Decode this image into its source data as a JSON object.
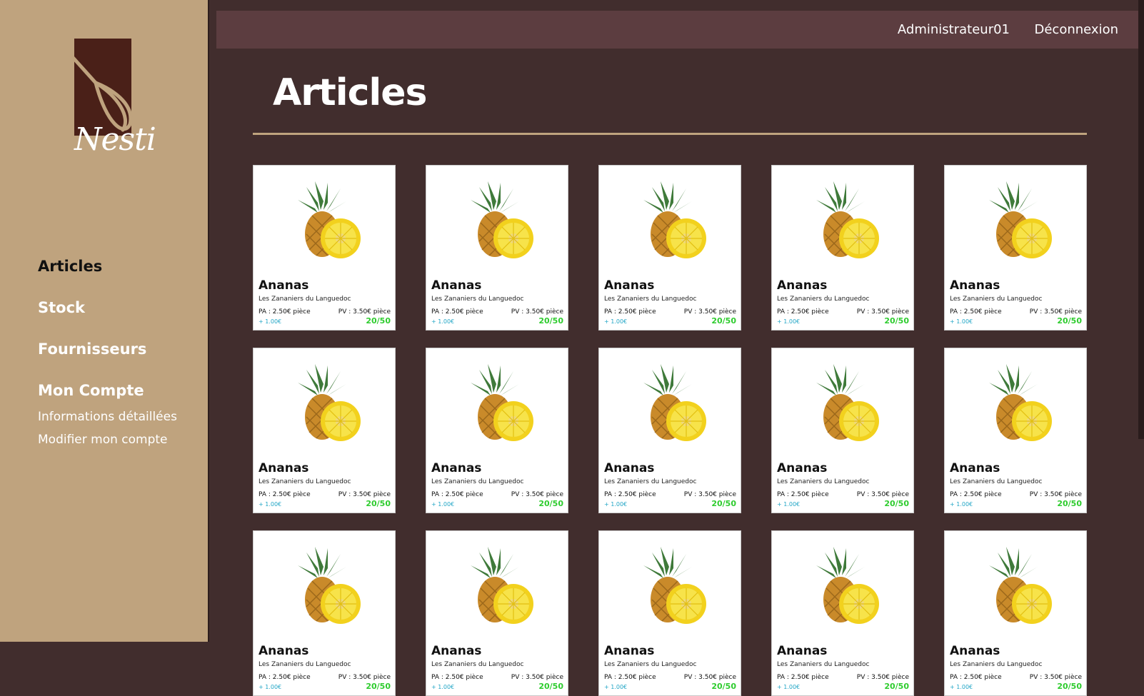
{
  "brand": {
    "logo_text": "Nesti"
  },
  "sidebar": {
    "items": [
      {
        "label": "Articles",
        "active": true
      },
      {
        "label": "Stock",
        "active": false
      },
      {
        "label": "Fournisseurs",
        "active": false
      },
      {
        "label": "Mon Compte",
        "active": false
      }
    ],
    "sub_items": [
      "Informations détaillées",
      "Modifier mon compte"
    ]
  },
  "topbar": {
    "user": "Administrateur01",
    "logout": "Déconnexion"
  },
  "page": {
    "title": "Articles"
  },
  "colors": {
    "sidebar_bg": "#bfa37e",
    "main_bg": "#412d2d",
    "topbar_bg": "#5c3d40",
    "stock_green": "#2ecc2e",
    "margin_blue": "#22a6c6"
  },
  "articles": [
    {
      "name": "Ananas",
      "supplier": "Les Zananiers du Languedoc",
      "pa": "PA : 2.50€ pièce",
      "pv": "PV : 3.50€ pièce",
      "margin": "+ 1.00€",
      "stock": "20/50",
      "icon": "pineapple-icon"
    },
    {
      "name": "Ananas",
      "supplier": "Les Zananiers du Languedoc",
      "pa": "PA : 2.50€ pièce",
      "pv": "PV : 3.50€ pièce",
      "margin": "+ 1.00€",
      "stock": "20/50",
      "icon": "pineapple-icon"
    },
    {
      "name": "Ananas",
      "supplier": "Les Zananiers du Languedoc",
      "pa": "PA : 2.50€ pièce",
      "pv": "PV : 3.50€ pièce",
      "margin": "+ 1.00€",
      "stock": "20/50",
      "icon": "pineapple-icon"
    },
    {
      "name": "Ananas",
      "supplier": "Les Zananiers du Languedoc",
      "pa": "PA : 2.50€ pièce",
      "pv": "PV : 3.50€ pièce",
      "margin": "+ 1.00€",
      "stock": "20/50",
      "icon": "pineapple-icon"
    },
    {
      "name": "Ananas",
      "supplier": "Les Zananiers du Languedoc",
      "pa": "PA : 2.50€ pièce",
      "pv": "PV : 3.50€ pièce",
      "margin": "+ 1.00€",
      "stock": "20/50",
      "icon": "pineapple-icon"
    },
    {
      "name": "Ananas",
      "supplier": "Les Zananiers du Languedoc",
      "pa": "PA : 2.50€ pièce",
      "pv": "PV : 3.50€ pièce",
      "margin": "+ 1.00€",
      "stock": "20/50",
      "icon": "pineapple-icon"
    },
    {
      "name": "Ananas",
      "supplier": "Les Zananiers du Languedoc",
      "pa": "PA : 2.50€ pièce",
      "pv": "PV : 3.50€ pièce",
      "margin": "+ 1.00€",
      "stock": "20/50",
      "icon": "pineapple-icon"
    },
    {
      "name": "Ananas",
      "supplier": "Les Zananiers du Languedoc",
      "pa": "PA : 2.50€ pièce",
      "pv": "PV : 3.50€ pièce",
      "margin": "+ 1.00€",
      "stock": "20/50",
      "icon": "pineapple-icon"
    },
    {
      "name": "Ananas",
      "supplier": "Les Zananiers du Languedoc",
      "pa": "PA : 2.50€ pièce",
      "pv": "PV : 3.50€ pièce",
      "margin": "+ 1.00€",
      "stock": "20/50",
      "icon": "pineapple-icon"
    },
    {
      "name": "Ananas",
      "supplier": "Les Zananiers du Languedoc",
      "pa": "PA : 2.50€ pièce",
      "pv": "PV : 3.50€ pièce",
      "margin": "+ 1.00€",
      "stock": "20/50",
      "icon": "pineapple-icon"
    },
    {
      "name": "Ananas",
      "supplier": "Les Zananiers du Languedoc",
      "pa": "PA : 2.50€ pièce",
      "pv": "PV : 3.50€ pièce",
      "margin": "+ 1.00€",
      "stock": "20/50",
      "icon": "pineapple-icon"
    },
    {
      "name": "Ananas",
      "supplier": "Les Zananiers du Languedoc",
      "pa": "PA : 2.50€ pièce",
      "pv": "PV : 3.50€ pièce",
      "margin": "+ 1.00€",
      "stock": "20/50",
      "icon": "pineapple-icon"
    },
    {
      "name": "Ananas",
      "supplier": "Les Zananiers du Languedoc",
      "pa": "PA : 2.50€ pièce",
      "pv": "PV : 3.50€ pièce",
      "margin": "+ 1.00€",
      "stock": "20/50",
      "icon": "pineapple-icon"
    },
    {
      "name": "Ananas",
      "supplier": "Les Zananiers du Languedoc",
      "pa": "PA : 2.50€ pièce",
      "pv": "PV : 3.50€ pièce",
      "margin": "+ 1.00€",
      "stock": "20/50",
      "icon": "pineapple-icon"
    },
    {
      "name": "Ananas",
      "supplier": "Les Zananiers du Languedoc",
      "pa": "PA : 2.50€ pièce",
      "pv": "PV : 3.50€ pièce",
      "margin": "+ 1.00€",
      "stock": "20/50",
      "icon": "pineapple-icon"
    }
  ]
}
